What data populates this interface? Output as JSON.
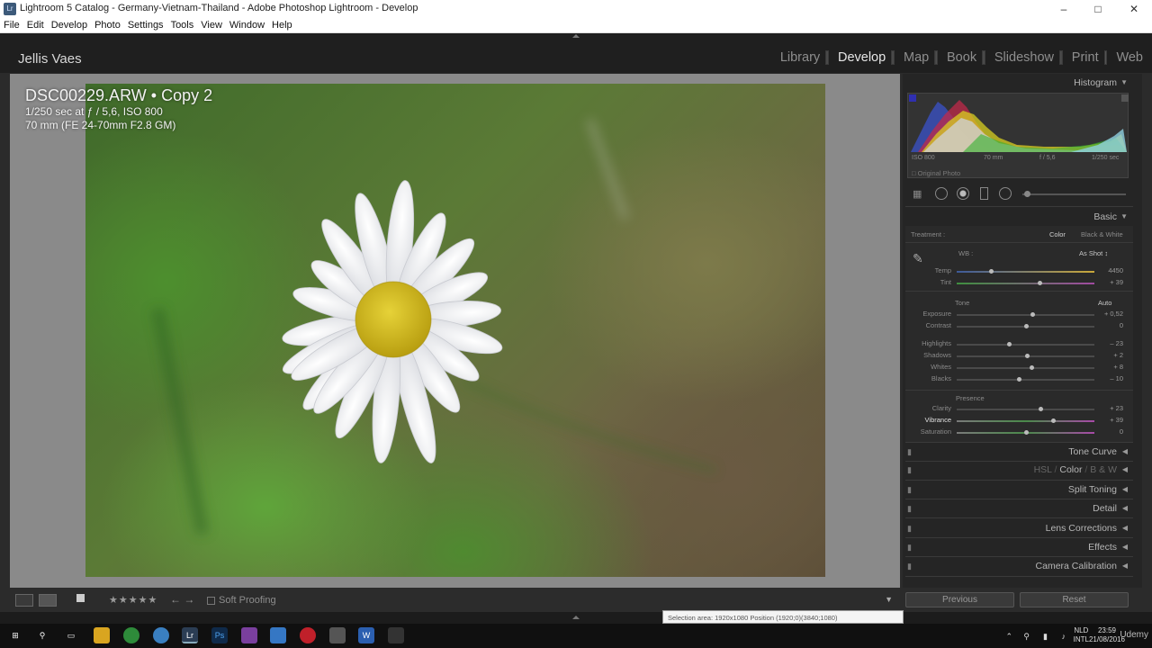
{
  "window": {
    "app_icon": "Lr",
    "title": "Lightroom 5 Catalog - Germany-Vietnam-Thailand - Adobe Photoshop Lightroom - Develop",
    "controls": {
      "minimize": "–",
      "maximize": "□",
      "close": "✕"
    }
  },
  "menu": [
    "File",
    "Edit",
    "Develop",
    "Photo",
    "Settings",
    "Tools",
    "View",
    "Window",
    "Help"
  ],
  "identity_plate": "Jellis Vaes",
  "modules": [
    "Library",
    "Develop",
    "Map",
    "Book",
    "Slideshow",
    "Print",
    "Web"
  ],
  "active_module": "Develop",
  "photo": {
    "filename": "DSC00229.ARW",
    "copy": "Copy 2",
    "separator": "•",
    "exposure_line": "1/250 sec at ƒ / 5,6, ISO 800",
    "lens_line": "70 mm (FE 24-70mm F2.8 GM)"
  },
  "toolbar": {
    "rating": "★★★★★",
    "soft_proofing": "Soft Proofing"
  },
  "histogram": {
    "title": "Histogram",
    "meta": [
      "ISO 800",
      "70 mm",
      "f / 5,6",
      "1/250 sec"
    ],
    "original_photo": "Original Photo"
  },
  "basic": {
    "title": "Basic",
    "treatment_label": "Treatment :",
    "treatment_color": "Color",
    "treatment_bw": "Black & White",
    "wb_label": "WB :",
    "wb_value": "As Shot ↕",
    "sliders_wb": [
      {
        "label": "Temp",
        "value": "4450",
        "pos": 0.25
      },
      {
        "label": "Tint",
        "value": "+ 39",
        "pos": 0.6
      }
    ],
    "tone_label": "Tone",
    "auto_label": "Auto",
    "sliders_tone": [
      {
        "label": "Exposure",
        "value": "+ 0,52",
        "pos": 0.55
      },
      {
        "label": "Contrast",
        "value": "0",
        "pos": 0.5
      }
    ],
    "sliders_tone2": [
      {
        "label": "Highlights",
        "value": "– 23",
        "pos": 0.38
      },
      {
        "label": "Shadows",
        "value": "+ 2",
        "pos": 0.51
      },
      {
        "label": "Whites",
        "value": "+ 8",
        "pos": 0.54
      },
      {
        "label": "Blacks",
        "value": "– 10",
        "pos": 0.45
      }
    ],
    "presence_label": "Presence",
    "sliders_presence": [
      {
        "label": "Clarity",
        "value": "+ 23",
        "pos": 0.61
      },
      {
        "label": "Vibrance",
        "value": "+ 39",
        "pos": 0.7
      },
      {
        "label": "Saturation",
        "value": "0",
        "pos": 0.5
      }
    ]
  },
  "panels": {
    "tone_curve": "Tone Curve",
    "hsl": "HSL",
    "color": "Color",
    "bw": "B & W",
    "split_toning": "Split Toning",
    "detail": "Detail",
    "lens_corrections": "Lens Corrections",
    "effects": "Effects",
    "camera_calibration": "Camera Calibration"
  },
  "buttons": {
    "previous": "Previous",
    "reset": "Reset"
  },
  "status_tooltip": "Selection area: 1920x1080 Position (1920;0)(3840;1080)",
  "taskbar": {
    "lang1": "NLD",
    "lang2": "INTL",
    "time": "23:59",
    "date": "21/08/2016",
    "watermark": "Udemy"
  },
  "colors": {
    "accent": "#e6e6e6",
    "panel_bg": "#252525",
    "flower_center": "#d8c11f"
  }
}
